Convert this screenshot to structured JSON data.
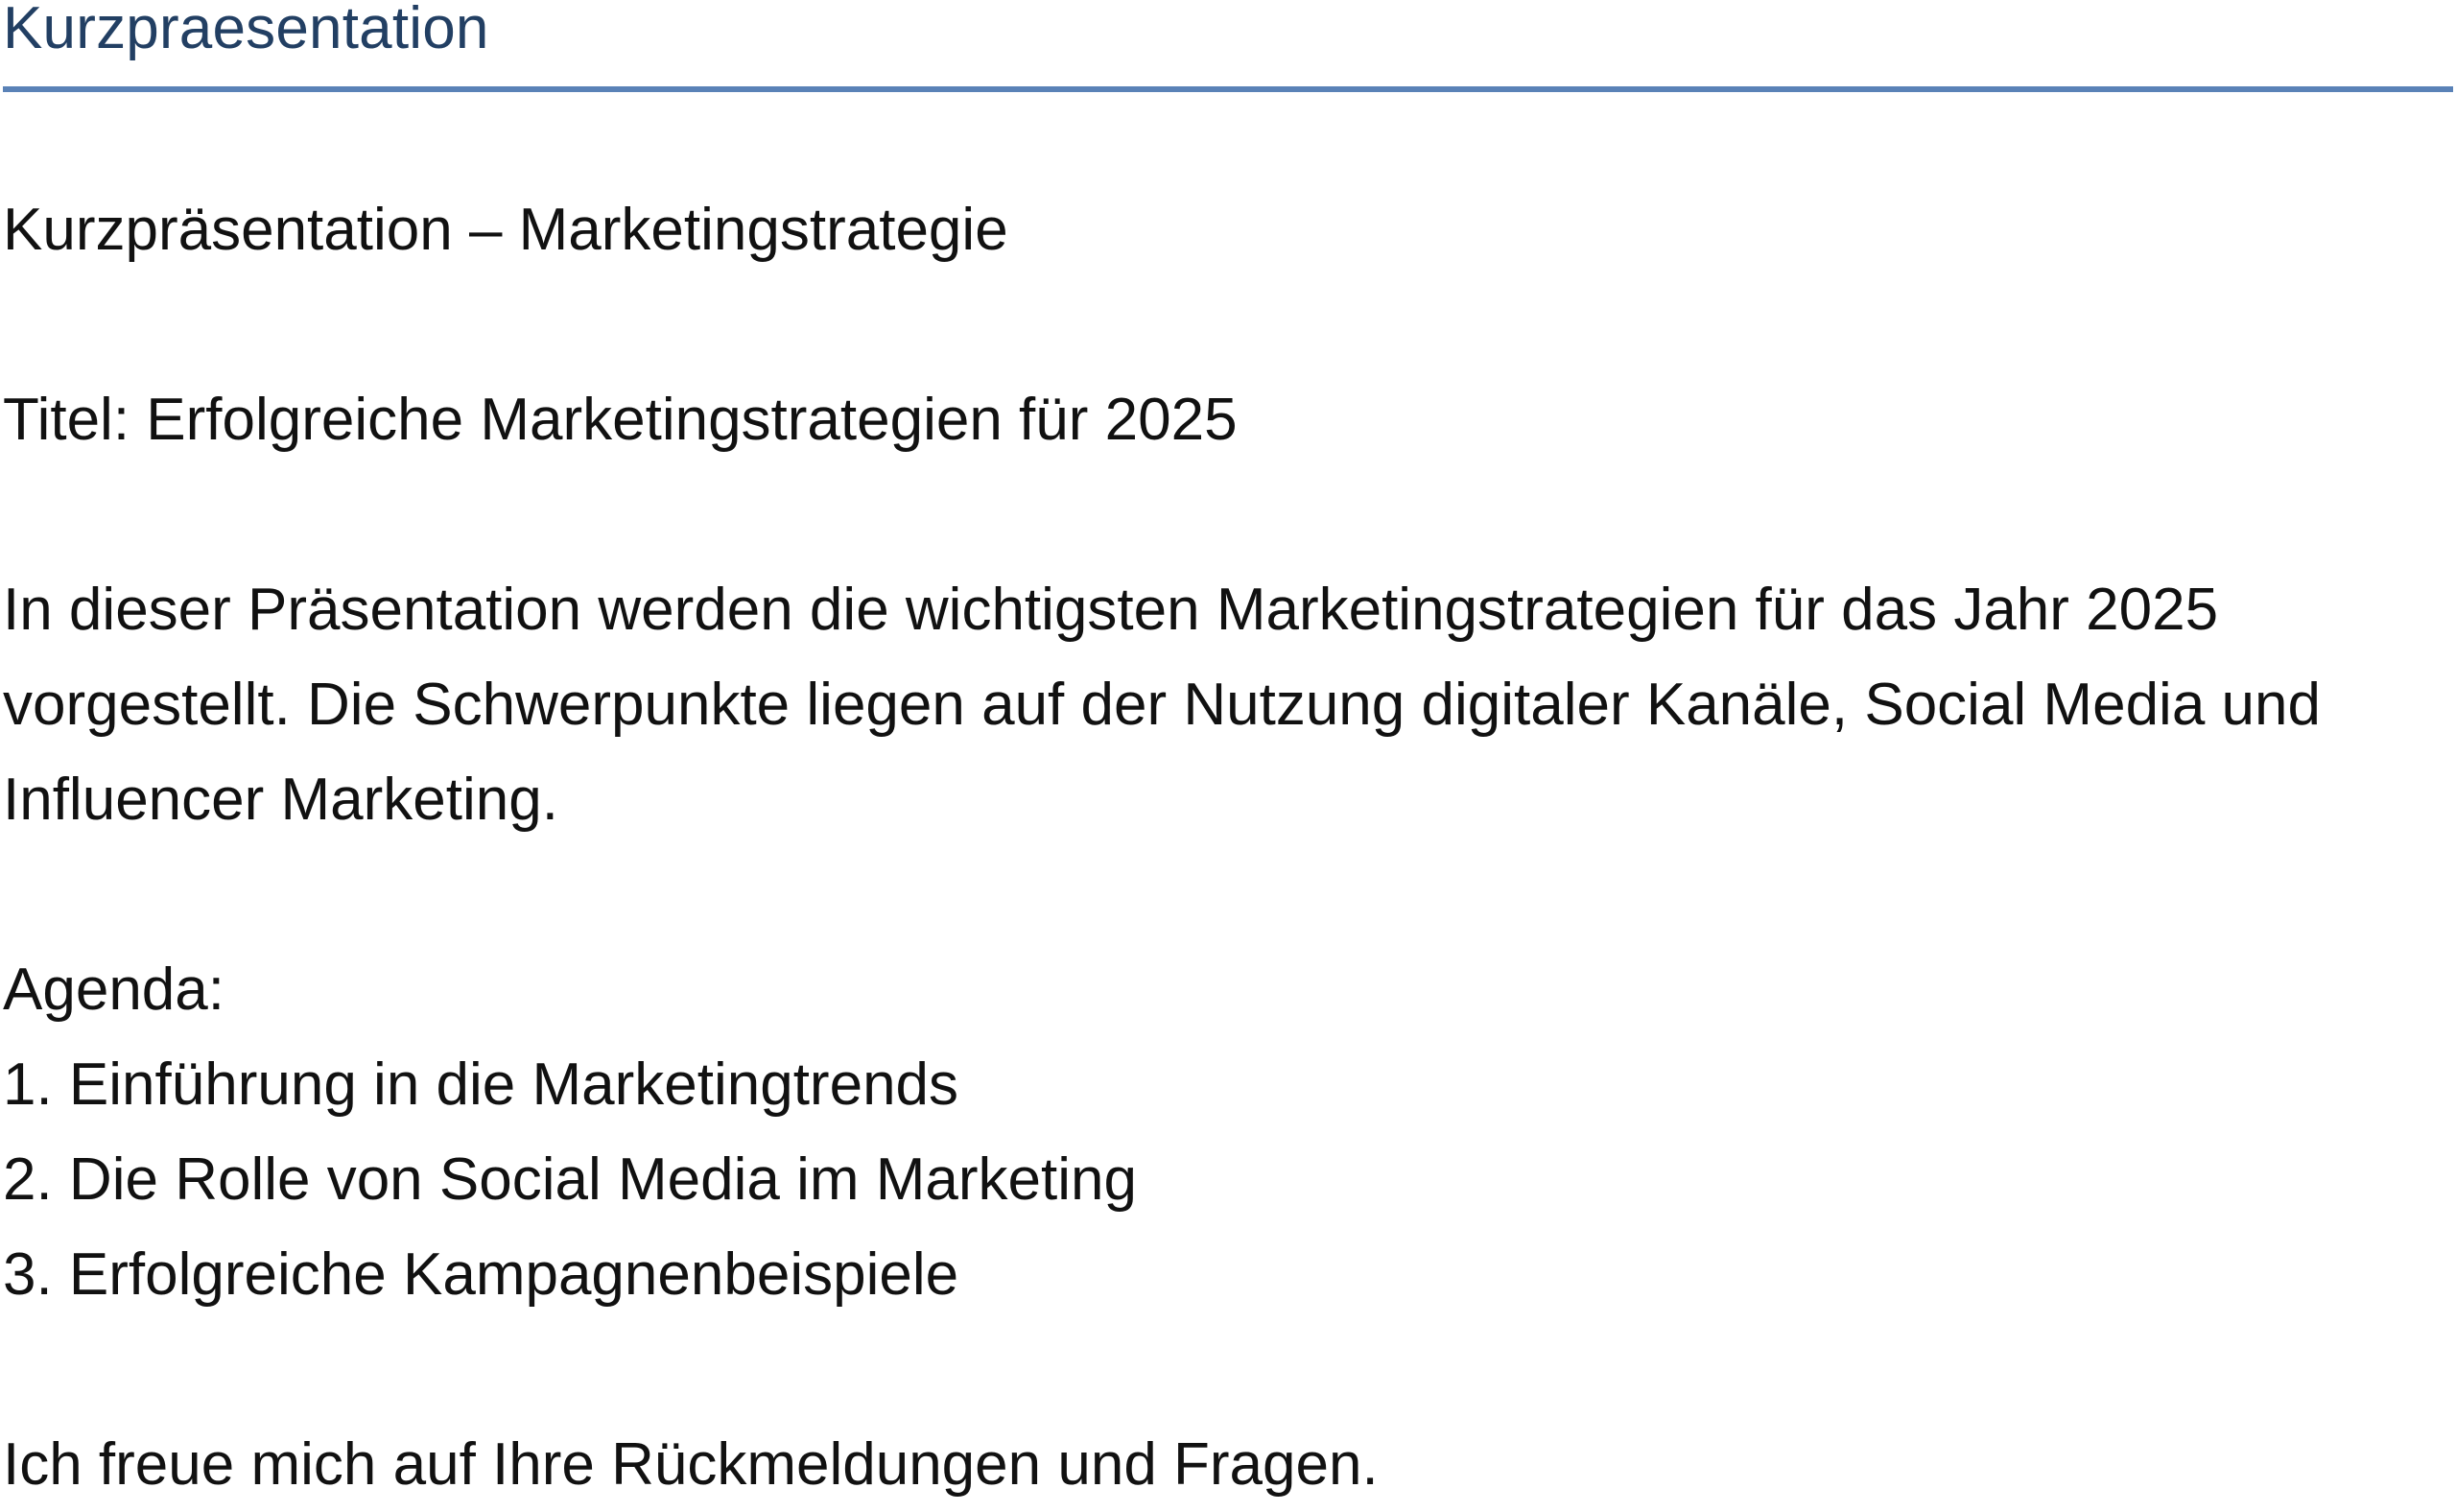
{
  "header": {
    "title": "Kurzpraesentation"
  },
  "document": {
    "heading": "Kurzpräsentation – Marketingstrategie",
    "title_line": "Titel: Erfolgreiche Marketingstrategien für 2025",
    "intro_lines": [
      "In dieser Präsentation werden die wichtigsten Marketingstrategien für das Jahr 2025",
      "vorgestellt. Die Schwerpunkte liegen auf der Nutzung digitaler Kanäle, Social Media und",
      "Influencer Marketing."
    ],
    "agenda_label": "Agenda:",
    "agenda_items": [
      "1. Einführung in die Marketingtrends",
      "2. Die Rolle von Social Media im Marketing",
      "3. Erfolgreiche Kampagnenbeispiele"
    ],
    "closing": "Ich freue mich auf Ihre Rückmeldungen und Fragen."
  },
  "colors": {
    "header_text": "#223f63",
    "header_rule": "#5a82b7",
    "body_text": "#111111",
    "background": "#ffffff"
  }
}
